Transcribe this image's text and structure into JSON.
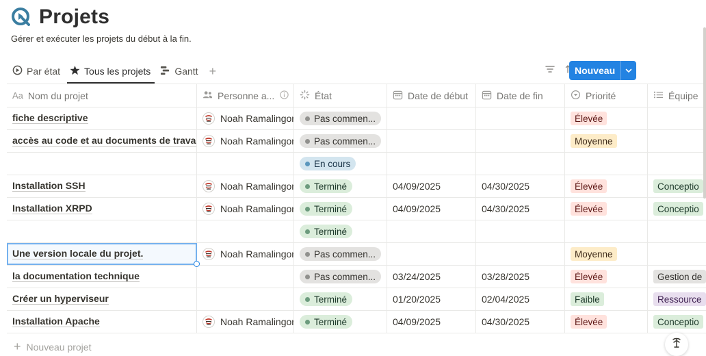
{
  "page": {
    "title": "Projets",
    "subtitle": "Gérer et exécuter les projets du début à la fin."
  },
  "views": [
    {
      "label": "Par état",
      "icon": "status-icon"
    },
    {
      "label": "Tous les projets",
      "icon": "star-icon",
      "active": true
    },
    {
      "label": "Gantt",
      "icon": "gantt-icon"
    }
  ],
  "toolbar": {
    "new_label": "Nouveau",
    "icons": [
      "filter-icon",
      "sort-icon",
      "automation-icon",
      "search-icon",
      "more-icon"
    ]
  },
  "columns": {
    "name": "Nom du projet",
    "person": "Personne a...",
    "status": "État",
    "start": "Date de début",
    "end": "Date de fin",
    "priority": "Priorité",
    "team": "Équipe"
  },
  "rows": [
    {
      "name": "fiche descriptive",
      "person": "Noah Ramalingon",
      "status": "Pas commen...",
      "status_type": "notstarted",
      "start": "",
      "end": "",
      "priority": "Élevée",
      "priority_type": "high",
      "team": "",
      "team_type": ""
    },
    {
      "name": "accès au code et au documents de travail",
      "person": "Noah Ramalingon",
      "status": "Pas commen...",
      "status_type": "notstarted",
      "start": "",
      "end": "",
      "priority": "Moyenne",
      "priority_type": "medium",
      "team": "",
      "team_type": ""
    },
    {
      "name": "",
      "person": "",
      "status": "En cours",
      "status_type": "progress",
      "start": "",
      "end": "",
      "priority": "",
      "priority_type": "",
      "team": "",
      "team_type": ""
    },
    {
      "name": "Installation SSH",
      "person": "Noah Ramalingon",
      "status": "Terminé",
      "status_type": "done",
      "start": "04/09/2025",
      "end": "04/30/2025",
      "priority": "Élevée",
      "priority_type": "high",
      "team": "Conceptio",
      "team_type": "green"
    },
    {
      "name": "Installation XRPD",
      "person": "Noah Ramalingon",
      "status": "Terminé",
      "status_type": "done",
      "start": "04/09/2025",
      "end": "04/30/2025",
      "priority": "Élevée",
      "priority_type": "high",
      "team": "Conceptio",
      "team_type": "green"
    },
    {
      "name": "",
      "person": "",
      "status": "Terminé",
      "status_type": "done",
      "start": "",
      "end": "",
      "priority": "",
      "priority_type": "",
      "team": "",
      "team_type": ""
    },
    {
      "name": "Une version locale du projet.",
      "person": "Noah Ramalingon",
      "status": "Pas commen...",
      "status_type": "notstarted",
      "start": "",
      "end": "",
      "priority": "Moyenne",
      "priority_type": "medium",
      "team": "",
      "team_type": "",
      "selected": true
    },
    {
      "name": "la documentation technique",
      "person": "",
      "status": "Pas commen...",
      "status_type": "notstarted",
      "start": "03/24/2025",
      "end": "03/28/2025",
      "priority": "Élevée",
      "priority_type": "high",
      "team": "Gestion de",
      "team_type": "gray"
    },
    {
      "name": "Créer un hyperviseur",
      "person": "",
      "status": "Terminé",
      "status_type": "done",
      "start": "01/20/2025",
      "end": "02/04/2025",
      "priority": "Faible",
      "priority_type": "low",
      "team": "Ressource",
      "team_type": "purple"
    },
    {
      "name": "Installation Apache",
      "person": "Noah Ramalingon",
      "status": "Terminé",
      "status_type": "done",
      "start": "04/09/2025",
      "end": "04/30/2025",
      "priority": "Élevée",
      "priority_type": "high",
      "team": "Conceptio",
      "team_type": "green"
    }
  ],
  "footer": {
    "new_row_label": "Nouveau projet"
  }
}
